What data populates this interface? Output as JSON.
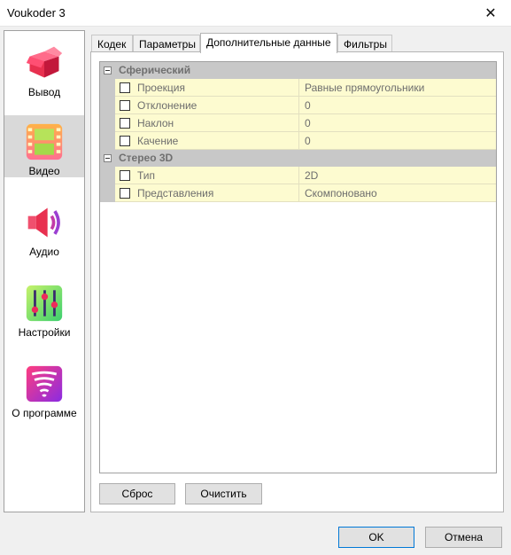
{
  "window": {
    "title": "Voukoder 3"
  },
  "sidebar": {
    "items": [
      {
        "label": "Вывод",
        "icon": "output-box-icon",
        "active": false
      },
      {
        "label": "Видео",
        "icon": "video-film-icon",
        "active": true
      },
      {
        "label": "Аудио",
        "icon": "audio-speaker-icon",
        "active": false
      },
      {
        "label": "Настройки",
        "icon": "settings-sliders-icon",
        "active": false
      },
      {
        "label": "О программе",
        "icon": "about-tornado-icon",
        "active": false
      }
    ]
  },
  "tabs": [
    {
      "label": "Кодек",
      "active": false
    },
    {
      "label": "Параметры",
      "active": false
    },
    {
      "label": "Дополнительные данные",
      "active": true
    },
    {
      "label": "Фильтры",
      "active": false
    }
  ],
  "groups": [
    {
      "label": "Сферический",
      "properties": [
        {
          "name": "Проекция",
          "value": "Равные прямоугольники",
          "checked": false
        },
        {
          "name": "Отклонение",
          "value": "0",
          "checked": false
        },
        {
          "name": "Наклон",
          "value": "0",
          "checked": false
        },
        {
          "name": "Качение",
          "value": "0",
          "checked": false
        }
      ]
    },
    {
      "label": "Стерео 3D",
      "properties": [
        {
          "name": "Тип",
          "value": "2D",
          "checked": false
        },
        {
          "name": "Представления",
          "value": "Скомпоновано",
          "checked": false
        }
      ]
    }
  ],
  "panel_buttons": {
    "reset": "Сброс",
    "clear": "Очистить"
  },
  "dialog_buttons": {
    "ok": "OK",
    "cancel": "Отмена"
  },
  "colors": {
    "property_background": "#fdfbd0",
    "group_header": "#c8c8c8",
    "selected_nav": "#d9d9d9"
  }
}
